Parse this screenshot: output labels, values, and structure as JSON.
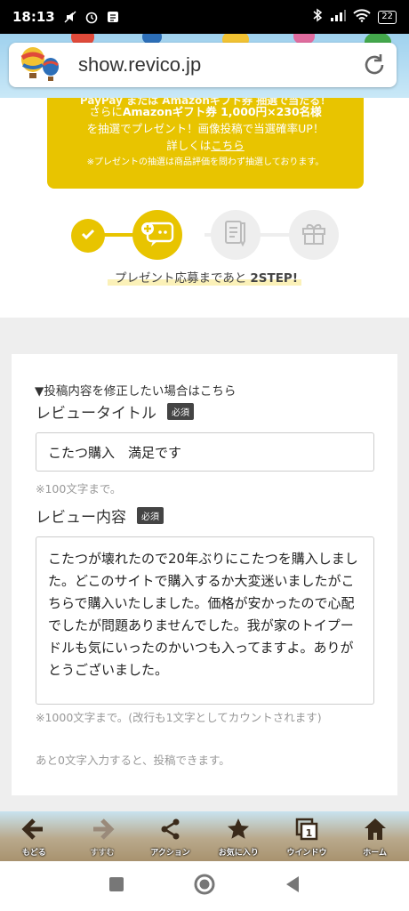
{
  "status_bar": {
    "time": "18:13",
    "battery": "22"
  },
  "browser": {
    "url": "show.revico.jp"
  },
  "notice": {
    "cut_line": "PayPay または Amazonギフト券 抽選で当たる！",
    "line1": "さらに",
    "line1_bold": "Amazonギフト券 1,000円×230名様",
    "line2": "を抽選でプレゼント！画像投稿で当選確率UP！",
    "line3_prefix": "詳しくは",
    "line3_link": "こちら",
    "line4": "※プレゼントの抽選は商品評価を問わず抽選しております。"
  },
  "steps": {
    "caption": "プレゼント応募まであと",
    "caption_bold": "2STEP!"
  },
  "form": {
    "edit_link": "▼投稿内容を修正したい場合はこちら",
    "title_label": "レビュータイトル",
    "required_badge": "必須",
    "title_value": "こたつ購入　満足です",
    "title_hint": "※100文字まで。",
    "body_label": "レビュー内容",
    "body_value": "こたつが壊れたので20年ぶりにこたつを購入しました。どこのサイトで購入するか大変迷いましたがこちらで購入いたしました。価格が安かったので心配でしたが問題ありませんでした。我が家のトイプードルも気にいったのかいつも入ってますよ。ありがとうございました。",
    "body_hint": "※1000文字まで。(改行も1文字としてカウントされます)",
    "remaining_hint": "あと0文字入力すると、投稿できます。"
  },
  "toolbar": {
    "items": [
      {
        "label": "もどる",
        "icon": "back-arrow-icon"
      },
      {
        "label": "すすむ",
        "icon": "forward-arrow-icon"
      },
      {
        "label": "アクション",
        "icon": "share-icon"
      },
      {
        "label": "お気に入り",
        "icon": "star-icon"
      },
      {
        "label": "ウインドウ",
        "icon": "window-icon",
        "count": "1"
      },
      {
        "label": "ホーム",
        "icon": "home-icon"
      }
    ]
  },
  "colors": {
    "accent": "#e8c400",
    "step_inactive": "#eeeeee",
    "dark": "#444444"
  }
}
